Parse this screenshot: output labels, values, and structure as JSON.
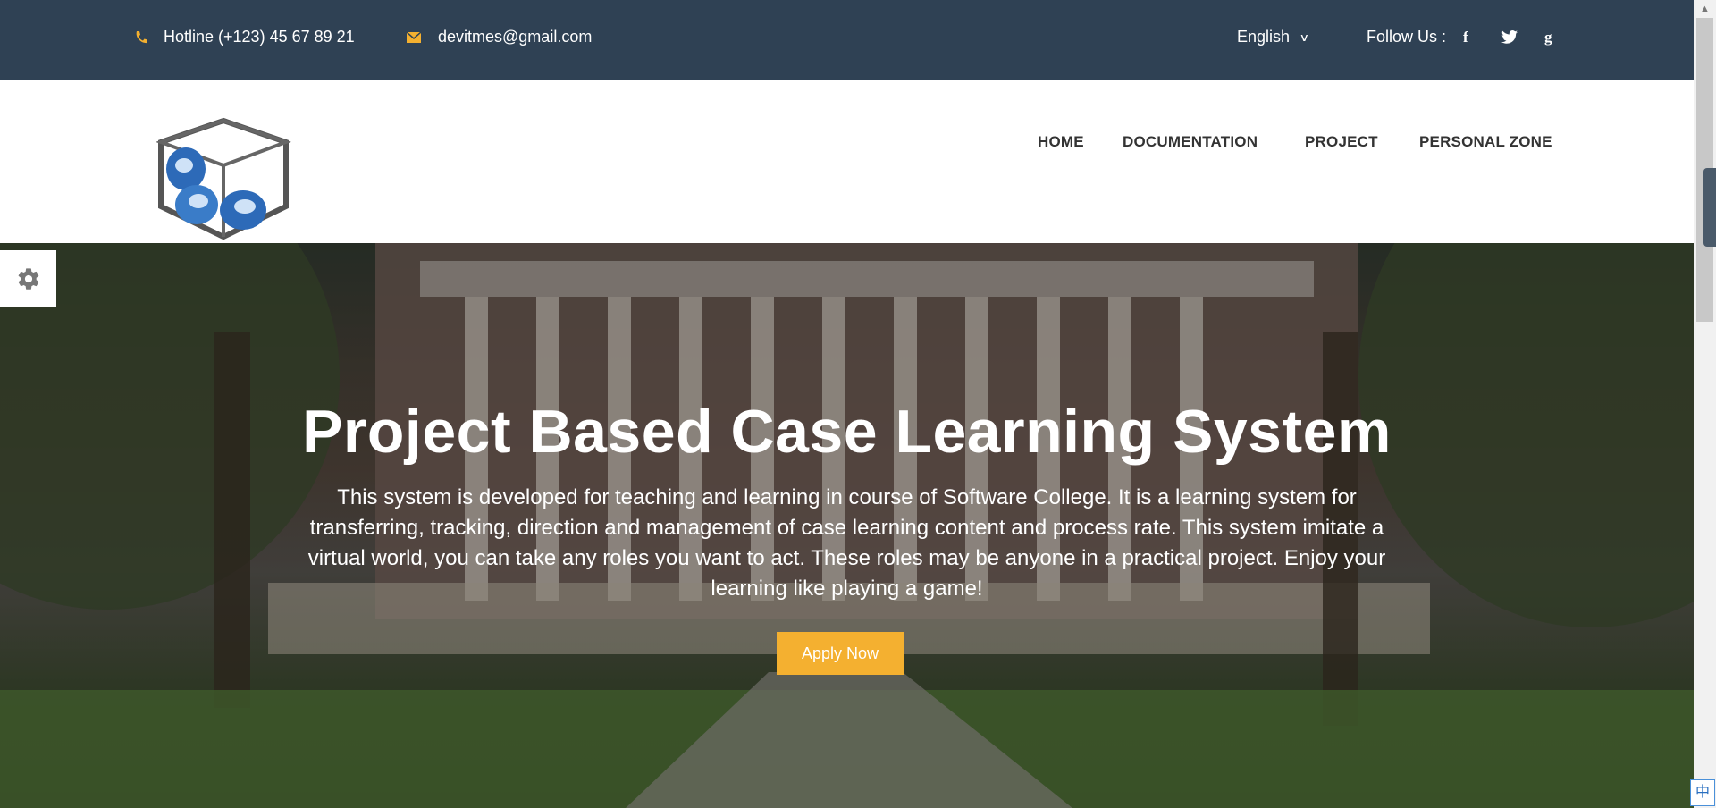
{
  "topbar": {
    "hotline": "Hotline (+123) 45 67 89 21",
    "email": "devitmes@gmail.com",
    "language": "English",
    "follow_label": "Follow Us :",
    "social": {
      "facebook": "f",
      "twitter": "twitter-icon",
      "google": "g"
    }
  },
  "nav": {
    "home": "HOME",
    "documentation": "DOCUMENTATION",
    "project": "PROJECT",
    "personal_zone": "PERSONAL ZONE"
  },
  "hero": {
    "title": "Project Based Case Learning System",
    "description": "This system is developed for teaching and learning in course of Software College. It is a learning system for transferring, tracking, direction and management of case learning content and process rate. This system imitate a virtual world, you can take any roles you want to act. These roles may be anyone in a practical project. Enjoy your learning like playing a game!",
    "cta": "Apply Now"
  },
  "ime": {
    "label": "中"
  },
  "colors": {
    "topbar": "#2f4154",
    "accent": "#f4b030",
    "nav_text": "#333333"
  },
  "icons": [
    "phone-icon",
    "mail-icon",
    "chevron-down-icon",
    "facebook-icon",
    "twitter-icon",
    "google-icon",
    "gear-icon",
    "logo-icon"
  ]
}
